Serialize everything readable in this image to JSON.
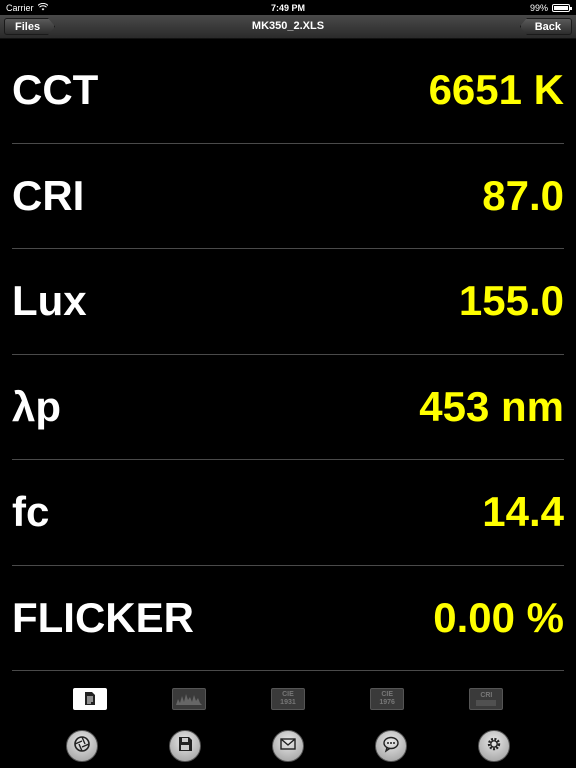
{
  "status_bar": {
    "carrier": "Carrier",
    "time": "7:49 PM",
    "battery_text": "99%",
    "battery_level": 0.99
  },
  "navbar": {
    "title": "MK350_2.XLS",
    "left_button": "Files",
    "right_button": "Back"
  },
  "measurements": [
    {
      "label": "CCT",
      "value": "6651 K"
    },
    {
      "label": "CRI",
      "value": "87.0"
    },
    {
      "label": "Lux",
      "value": "155.0"
    },
    {
      "label": "λp",
      "value": "453 nm"
    },
    {
      "label": "fc",
      "value": "14.4"
    },
    {
      "label": "FLICKER",
      "value": "0.00 %"
    }
  ],
  "page_tabs": [
    {
      "icon": "document-icon",
      "active": true
    },
    {
      "icon": "spectrum-icon",
      "active": false
    },
    {
      "icon": "cie-1931-icon",
      "text_top": "CIE",
      "text_bottom": "1931",
      "active": false
    },
    {
      "icon": "cie-1976-icon",
      "text_top": "CIE",
      "text_bottom": "1976",
      "active": false
    },
    {
      "icon": "cri-icon",
      "text_top": "CRI",
      "active": false
    }
  ],
  "toolbar": [
    {
      "icon": "aperture-icon"
    },
    {
      "icon": "save-icon"
    },
    {
      "icon": "mail-icon"
    },
    {
      "icon": "chat-icon"
    },
    {
      "icon": "gear-icon"
    }
  ],
  "colors": {
    "value": "#ffff00",
    "label": "#ffffff",
    "background": "#000000"
  }
}
